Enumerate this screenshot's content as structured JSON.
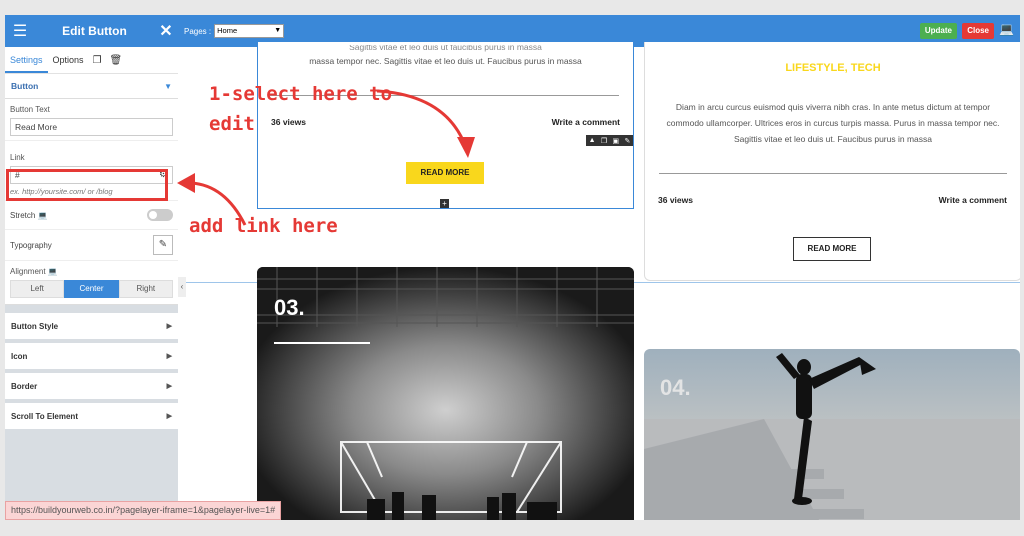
{
  "panel": {
    "title": "Edit Button",
    "tabs": [
      {
        "label": "Settings"
      },
      {
        "label": "Options"
      }
    ],
    "section": "Button",
    "button_text_label": "Button Text",
    "button_text_value": "Read More",
    "link_label": "Link",
    "link_value": "#",
    "link_hint": "ex. http://yoursite.com/ or /blog",
    "stretch_label": "Stretch",
    "typography_label": "Typography",
    "alignment_label": "Alignment",
    "align_options": [
      "Left",
      "Center",
      "Right"
    ],
    "align_selected": "Center",
    "accordions": [
      "Button Style",
      "Icon",
      "Border",
      "Scroll To Element"
    ]
  },
  "topbar": {
    "pages_label": "Pages :",
    "pages_value": "Home",
    "update_label": "Update",
    "close_label": "Close"
  },
  "card1": {
    "text_line1": "massa tempor nec. Sagittis vitae et leo duis ut. Faucibus purus in massa",
    "views": "36 views",
    "comment": "Write a comment",
    "readmore": "READ MORE"
  },
  "card2": {
    "category": "LIFESTYLE, TECH",
    "text": "Diam in arcu curcus euismod quis viverra nibh cras. In ante metus dictum at tempor commodo ullamcorper. Ultrices eros in curcus turpis massa. Purus in massa tempor nec. Sagittis vitae et leo duis ut. Faucibus purus in massa",
    "views": "36 views",
    "comment": "Write a comment",
    "readmore": "READ MORE"
  },
  "tiles": {
    "num3": "03.",
    "num4": "04."
  },
  "annotations": {
    "select": "1-select here to edit",
    "link": "add link here"
  },
  "status_url": "https://buildyourweb.co.in/?pagelayer-iframe=1&pagelayer-live=1#",
  "colors": {
    "accent": "#3a88d8",
    "highlight": "#e53935",
    "button_yellow": "#f9d71c",
    "update_green": "#4caf50"
  }
}
